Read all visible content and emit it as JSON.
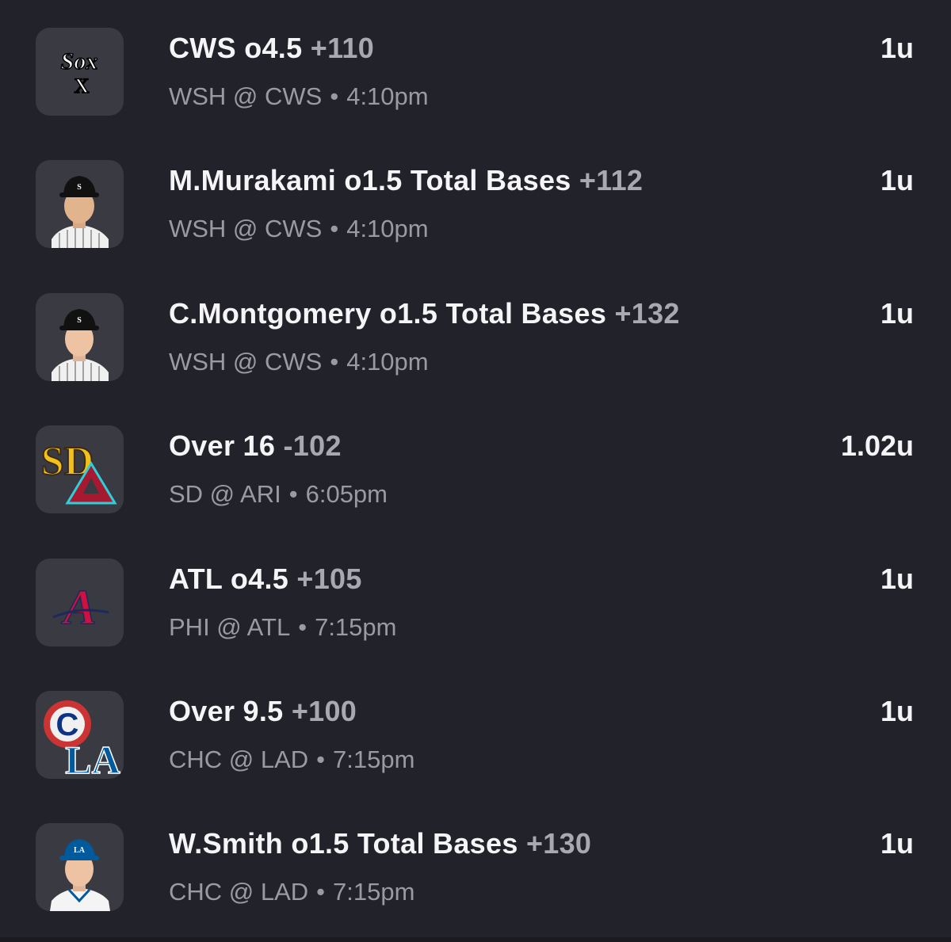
{
  "bets": [
    {
      "pick": "CWS o4.5",
      "odds": "+110",
      "matchup": "WSH @ CWS",
      "separator": "•",
      "time": "4:10pm",
      "units": "1u",
      "icon": "white-sox-logo-icon"
    },
    {
      "pick": "M.Murakami o1.5 Total Bases",
      "odds": "+112",
      "matchup": "WSH @ CWS",
      "separator": "•",
      "time": "4:10pm",
      "units": "1u",
      "icon": "player-headshot-icon"
    },
    {
      "pick": "C.Montgomery o1.5 Total Bases",
      "odds": "+132",
      "matchup": "WSH @ CWS",
      "separator": "•",
      "time": "4:10pm",
      "units": "1u",
      "icon": "player-headshot-icon"
    },
    {
      "pick": "Over 16",
      "odds": "-102",
      "matchup": "SD @ ARI",
      "separator": "•",
      "time": "6:05pm",
      "units": "1.02u",
      "icon": "padres-diamondbacks-logo-icon"
    },
    {
      "pick": "ATL o4.5",
      "odds": "+105",
      "matchup": "PHI @ ATL",
      "separator": "•",
      "time": "7:15pm",
      "units": "1u",
      "icon": "braves-logo-icon"
    },
    {
      "pick": "Over 9.5",
      "odds": "+100",
      "matchup": "CHC @ LAD",
      "separator": "•",
      "time": "7:15pm",
      "units": "1u",
      "icon": "cubs-dodgers-logo-icon"
    },
    {
      "pick": "W.Smith o1.5 Total Bases",
      "odds": "+130",
      "matchup": "CHC @ LAD",
      "separator": "•",
      "time": "7:15pm",
      "units": "1u",
      "icon": "player-headshot-icon"
    }
  ],
  "logos": {
    "white_sox": "Sox",
    "padres": "SD",
    "diamondbacks": "A",
    "braves": "A",
    "cubs": "C",
    "dodgers": "LA"
  },
  "colors": {
    "background": "#22222a",
    "tile": "#3a3a42",
    "primary_text": "#f5f5f7",
    "secondary_text": "#9a9aa2",
    "padres_gold": "#f2c018",
    "dbacks_red": "#a71930",
    "dbacks_teal": "#30ced8",
    "braves_red": "#ce1141",
    "cubs_blue": "#0e3386",
    "cubs_red": "#cc3433",
    "dodgers_blue": "#005a9c"
  }
}
